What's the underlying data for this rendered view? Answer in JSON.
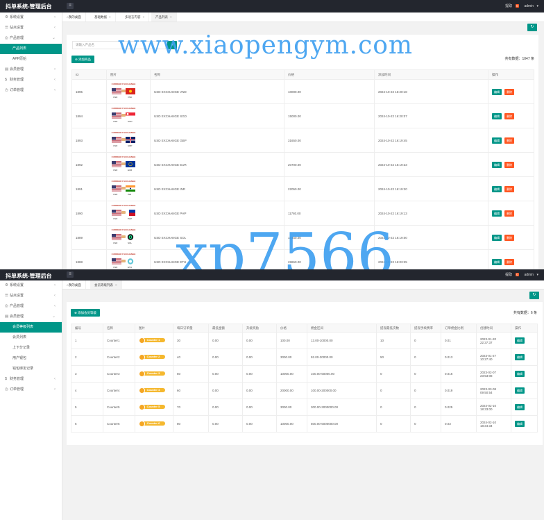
{
  "screen1": {
    "app_title": "抖单系统-管理后台",
    "top_right": {
      "notice_label": "提取",
      "notice_count": "0",
      "user": "admin"
    },
    "sidebar": [
      {
        "icon": "⚙",
        "label": "系统设置",
        "arrow": "‹",
        "state": ""
      },
      {
        "icon": "☰",
        "label": "站点设置",
        "arrow": "‹",
        "state": ""
      },
      {
        "icon": "◎",
        "label": "产品管理",
        "arrow": "⌄",
        "state": ""
      },
      {
        "icon": "",
        "label": "产品列表",
        "arrow": "",
        "state": "sub active"
      },
      {
        "icon": "",
        "label": "APP原始",
        "arrow": "",
        "state": "sub"
      },
      {
        "icon": "▤",
        "label": "会员管理",
        "arrow": "‹",
        "state": ""
      },
      {
        "icon": "$",
        "label": "财务管理",
        "arrow": "‹",
        "state": ""
      },
      {
        "icon": "◷",
        "label": "订单管理",
        "arrow": "‹",
        "state": ""
      }
    ],
    "tabs": [
      {
        "icon": "⌂",
        "label": "我的桌面"
      },
      {
        "icon": "",
        "label": "基础数据"
      },
      {
        "icon": "",
        "label": "多语言内容"
      },
      {
        "icon": "",
        "label": "产品列表"
      }
    ],
    "search_placeholder": "请输入产品名",
    "add_button": "⊕ 添加商品",
    "total": "共有数据：1047 条",
    "columns": [
      "ID",
      "图片",
      "名称",
      "价格",
      "添加时间",
      "操作"
    ],
    "flag_caption": "CURRENCY EXCHANGE",
    "rows": [
      {
        "id": "1895",
        "name": "USD EXCHANGE VND",
        "price": "10000.00",
        "time": "2024-10-22 16:20:18",
        "fa": "us",
        "fb": "vn",
        "la": "USD",
        "lb": "VND"
      },
      {
        "id": "1894",
        "name": "USD EXCHANGE SGD",
        "price": "15000.00",
        "time": "2024-10-22 16:20:07",
        "fa": "us",
        "fb": "sg",
        "la": "USD",
        "lb": "SGD"
      },
      {
        "id": "1893",
        "name": "USD EXCHANGE GBP",
        "price": "31650.00",
        "time": "2024-10-22 16:19:45",
        "fa": "us",
        "fb": "gb",
        "la": "USD",
        "lb": "GBP"
      },
      {
        "id": "1892",
        "name": "USD EXCHANGE EUR",
        "price": "20700.00",
        "time": "2024-10-22 16:19:33",
        "fa": "us",
        "fb": "eu",
        "la": "USD",
        "lb": "EUR"
      },
      {
        "id": "1891",
        "name": "USD EXCHANGE INR",
        "price": "22050.00",
        "time": "2024-10-22 16:19:20",
        "fa": "us",
        "fb": "in",
        "la": "USD",
        "lb": "INR"
      },
      {
        "id": "1890",
        "name": "USD EXCHANGE PHP",
        "price": "11780.00",
        "time": "2024-10-22 16:19:13",
        "fa": "us",
        "fb": "ph",
        "la": "USD",
        "lb": "PHP"
      },
      {
        "id": "1889",
        "name": "USD EXCHANGE SOL",
        "price": "15450.00",
        "time": "2024-10-22 16:19:00",
        "fa": "us",
        "fb": "sol",
        "la": "USD",
        "lb": "SOL"
      },
      {
        "id": "1888",
        "name": "USD EXCHANGE ETH",
        "price": "28650.00",
        "time": "2024-10-22 16:03:25",
        "fa": "us",
        "fb": "eth",
        "la": "USD",
        "lb": "ETH"
      }
    ],
    "edit_label": "编辑",
    "delete_label": "删除",
    "refresh_icon": "↻"
  },
  "screen2": {
    "app_title": "抖单系统-管理后台",
    "top_right": {
      "notice_label": "提取",
      "notice_count": "0",
      "user": "admin"
    },
    "sidebar": [
      {
        "icon": "⚙",
        "label": "系统设置",
        "arrow": "‹",
        "state": ""
      },
      {
        "icon": "☰",
        "label": "站点设置",
        "arrow": "‹",
        "state": ""
      },
      {
        "icon": "◎",
        "label": "产品管理",
        "arrow": "‹",
        "state": ""
      },
      {
        "icon": "▤",
        "label": "会员管理",
        "arrow": "⌄",
        "state": ""
      },
      {
        "icon": "",
        "label": "会员等级列表",
        "arrow": "",
        "state": "sub active"
      },
      {
        "icon": "",
        "label": "会员列表",
        "arrow": "",
        "state": "sub"
      },
      {
        "icon": "",
        "label": "上下分记录",
        "arrow": "",
        "state": "sub"
      },
      {
        "icon": "",
        "label": "用户银包",
        "arrow": "",
        "state": "sub"
      },
      {
        "icon": "",
        "label": "钱包绑定记录",
        "arrow": "",
        "state": "sub"
      },
      {
        "icon": "$",
        "label": "财务管理",
        "arrow": "‹",
        "state": ""
      },
      {
        "icon": "◷",
        "label": "订单管理",
        "arrow": "‹",
        "state": ""
      }
    ],
    "tabs": [
      {
        "icon": "⌂",
        "label": "我的桌面"
      },
      {
        "icon": "",
        "label": "会员等级列表"
      }
    ],
    "add_button": "⊕ 添加会员等级",
    "total": "共有数据：6 条",
    "columns": [
      "编号",
      "名称",
      "图片",
      "每日订单量",
      "最低金额",
      "升级奖励",
      "价格",
      "佣金区间",
      "提现最低次数",
      "提现手续费率",
      "订单佣金比例",
      "创建时间",
      "操作"
    ],
    "rows": [
      {
        "id": "1",
        "name": "Counter1",
        "badge": "Counter 1",
        "orders": "30",
        "min": "0.00",
        "reward": "0.00",
        "price": "100.00",
        "range": "13.00-10000.00",
        "wmin": "10",
        "fee": "0",
        "ratio": "0.01",
        "time": "2023-01-20 22:37:37"
      },
      {
        "id": "2",
        "name": "Counter2",
        "badge": "Counter 2",
        "orders": "40",
        "min": "0.00",
        "reward": "0.00",
        "price": "3000.00",
        "range": "92.00-30000.00",
        "wmin": "50",
        "fee": "0",
        "ratio": "0.013",
        "time": "2023-01-27 10:27:40"
      },
      {
        "id": "3",
        "name": "Counter3",
        "badge": "Counter 3",
        "orders": "50",
        "min": "0.00",
        "reward": "0.00",
        "price": "10000.00",
        "range": "100.00-50000.00",
        "wmin": "0",
        "fee": "0",
        "ratio": "0.016",
        "time": "2023-02-07 23:53:08"
      },
      {
        "id": "4",
        "name": "Counter4",
        "badge": "Counter 4",
        "orders": "60",
        "min": "0.00",
        "reward": "0.00",
        "price": "20000.00",
        "range": "100.00-200000.00",
        "wmin": "0",
        "fee": "0",
        "ratio": "0.019",
        "time": "2023-03-08 09:50:54"
      },
      {
        "id": "5",
        "name": "Counter5",
        "badge": "Counter 5",
        "orders": "70",
        "min": "0.00",
        "reward": "0.00",
        "price": "3000.00",
        "range": "300.00-3000000.00",
        "wmin": "0",
        "fee": "0",
        "ratio": "0.025",
        "time": "2024-02-10 18:33:00"
      },
      {
        "id": "6",
        "name": "Counter6",
        "badge": "Counter 6",
        "orders": "80",
        "min": "0.00",
        "reward": "0.00",
        "price": "10000.00",
        "range": "500.00-5000000.00",
        "wmin": "0",
        "fee": "0",
        "ratio": "0.03",
        "time": "2024-02-10 18:34:34"
      }
    ],
    "edit_label": "编辑",
    "refresh_icon": "↻"
  },
  "watermarks": {
    "site": "www.xiaopengym.com",
    "code": "xp7566"
  },
  "flag_colors": {
    "us_blue": "#3c3b6e",
    "us_red": "#b22234",
    "accent": "#009688",
    "danger": "#ff5722",
    "topbar": "#23262e"
  }
}
